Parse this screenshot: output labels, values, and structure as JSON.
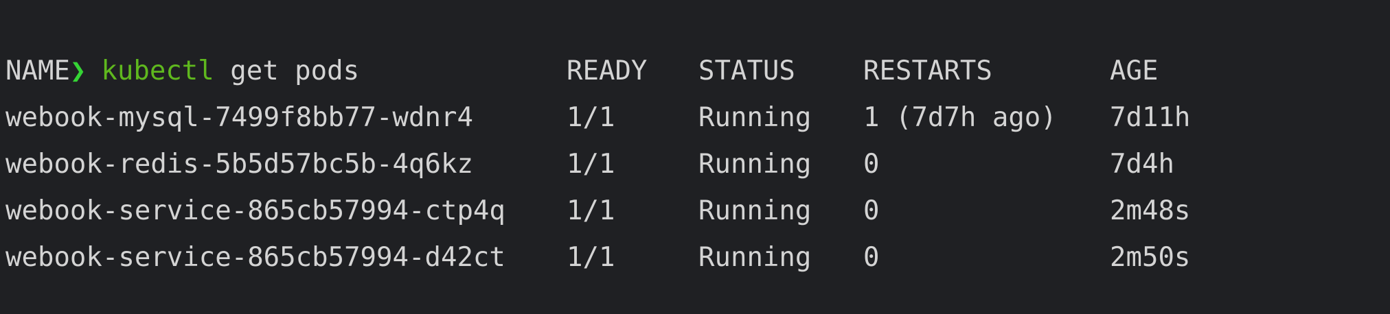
{
  "prompt": {
    "symbol": "❯",
    "command": "kubectl",
    "args": "get pods"
  },
  "table": {
    "headers": [
      "NAME",
      "READY",
      "STATUS",
      "RESTARTS",
      "AGE"
    ],
    "rows": [
      [
        "webook-mysql-7499f8bb77-wdnr4",
        "1/1",
        "Running",
        "1 (7d7h ago)",
        "7d11h"
      ],
      [
        "webook-redis-5b5d57bc5b-4q6kz",
        "1/1",
        "Running",
        "0",
        "7d4h"
      ],
      [
        "webook-service-865cb57994-ctp4q",
        "1/1",
        "Running",
        "0",
        "2m48s"
      ],
      [
        "webook-service-865cb57994-d42ct",
        "1/1",
        "Running",
        "0",
        "2m50s"
      ]
    ]
  },
  "colors": {
    "background": "#1f2023",
    "text": "#d4d4d4",
    "prompt_symbol": "#35d435",
    "command": "#5fb81e"
  }
}
